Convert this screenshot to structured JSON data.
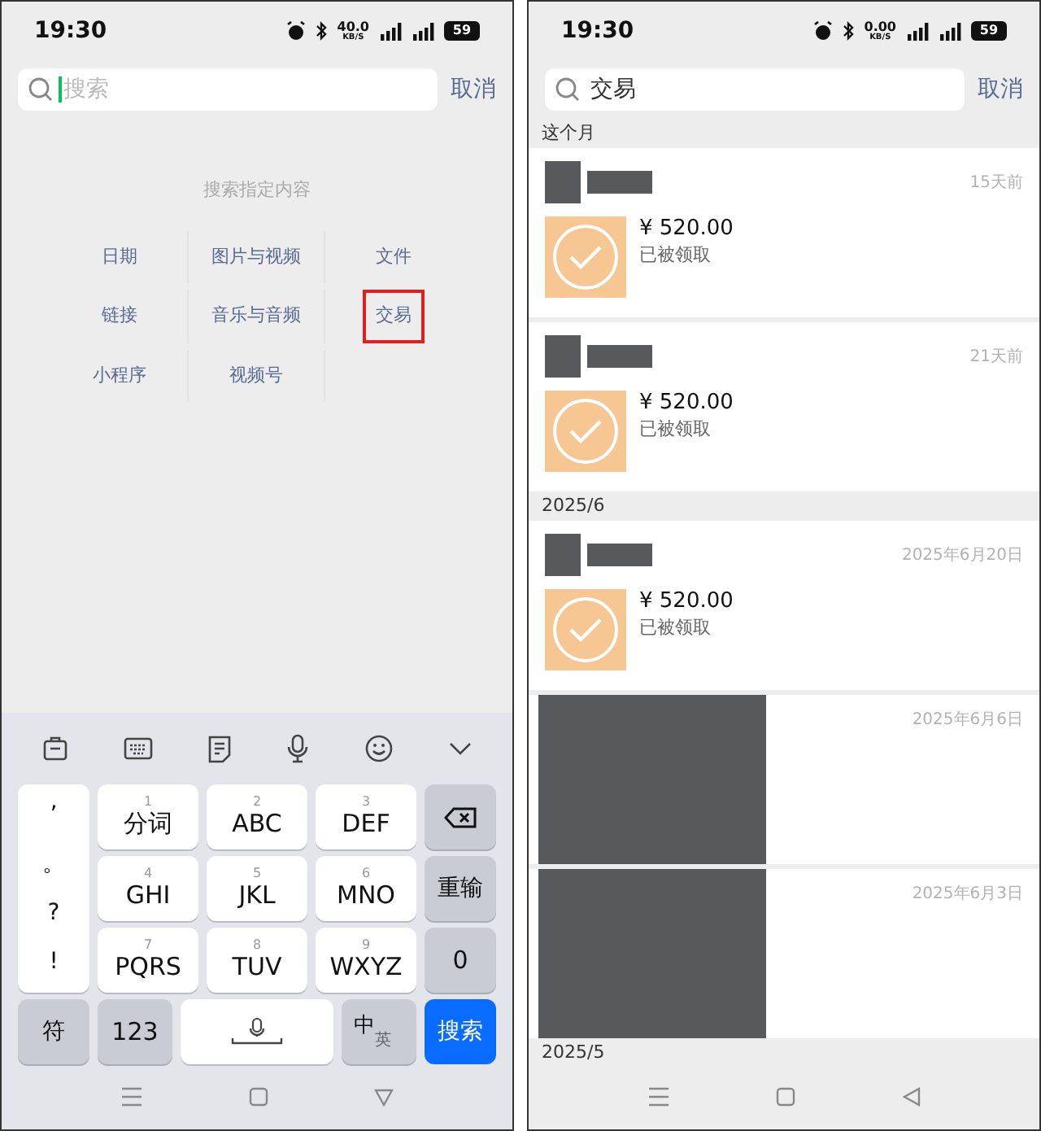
{
  "left": {
    "status_bar": {
      "time": "19:30",
      "speed": "40.0",
      "speed_unit": "KB/S",
      "battery": "59"
    },
    "search": {
      "placeholder": "搜索",
      "cancel": "取消"
    },
    "hint": "搜索指定内容",
    "categories": [
      {
        "label": "日期",
        "highlighted": false
      },
      {
        "label": "图片与视频",
        "highlighted": false
      },
      {
        "label": "文件",
        "highlighted": false
      },
      {
        "label": "链接",
        "highlighted": false
      },
      {
        "label": "音乐与音频",
        "highlighted": false
      },
      {
        "label": "交易",
        "highlighted": true
      },
      {
        "label": "小程序",
        "highlighted": false
      },
      {
        "label": "视频号",
        "highlighted": false
      }
    ],
    "keyboard": {
      "punctuation": [
        "’",
        "。",
        "?",
        "!"
      ],
      "keys": [
        {
          "digit": "1",
          "label": "分词"
        },
        {
          "digit": "2",
          "label": "ABC"
        },
        {
          "digit": "3",
          "label": "DEF"
        },
        {
          "digit": "4",
          "label": "GHI"
        },
        {
          "digit": "5",
          "label": "JKL"
        },
        {
          "digit": "6",
          "label": "MNO"
        },
        {
          "digit": "7",
          "label": "PQRS"
        },
        {
          "digit": "8",
          "label": "TUV"
        },
        {
          "digit": "9",
          "label": "WXYZ"
        }
      ],
      "retype": "重输",
      "zero": "0",
      "symbols": "符",
      "numbers": "123",
      "lang_main": "中",
      "lang_alt": "英",
      "search": "搜索"
    }
  },
  "right": {
    "status_bar": {
      "time": "19:30",
      "speed": "0.00",
      "speed_unit": "KB/S",
      "battery": "59"
    },
    "search": {
      "value": "交易",
      "cancel": "取消"
    },
    "sections": [
      {
        "title": "这个月",
        "items": [
          {
            "kind": "transfer",
            "time": "15天前",
            "amount": "¥ 520.00",
            "status": "已被领取"
          },
          {
            "kind": "transfer",
            "time": "21天前",
            "amount": "¥ 520.00",
            "status": "已被领取"
          }
        ]
      },
      {
        "title": "2025/6",
        "items": [
          {
            "kind": "transfer",
            "time": "2025年6月20日",
            "amount": "¥ 520.00",
            "status": "已被领取"
          },
          {
            "kind": "redacted",
            "time": "2025年6月6日"
          },
          {
            "kind": "redacted",
            "time": "2025年6月3日"
          }
        ]
      },
      {
        "title": "2025/5"
      }
    ]
  }
}
